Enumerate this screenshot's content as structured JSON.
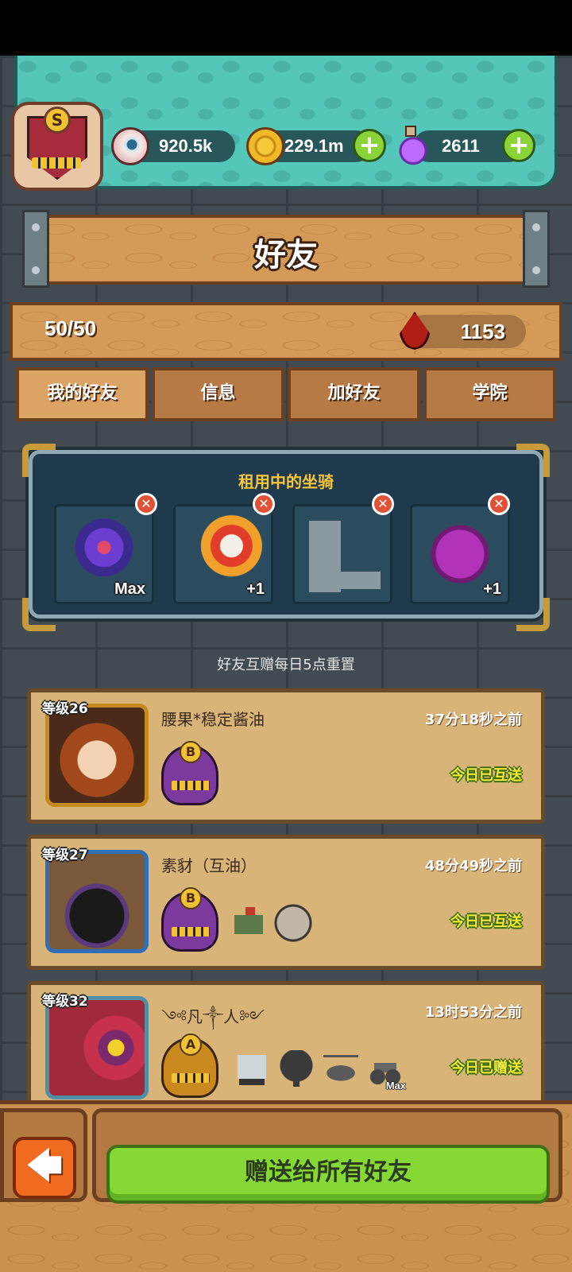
{
  "resources": {
    "eyes": "920.5k",
    "coins": "229.1m",
    "potions": "2611",
    "rank_letter": "S"
  },
  "header": {
    "title": "好友"
  },
  "friends_count": "50/50",
  "blood": "1153",
  "tabs": [
    {
      "label": "我的好友",
      "active": true
    },
    {
      "label": "信息",
      "active": false
    },
    {
      "label": "加好友",
      "active": false
    },
    {
      "label": "学院",
      "active": false
    }
  ],
  "rented_mounts": {
    "title": "租用中的坐骑",
    "slots": [
      {
        "icon": "rose-mount-icon",
        "badge": "Max"
      },
      {
        "icon": "lion-dance-mount-icon",
        "badge": "+1"
      },
      {
        "icon": "machine-mount-icon",
        "badge": ""
      },
      {
        "icon": "purple-monster-mount-icon",
        "badge": "+1"
      }
    ]
  },
  "reset_note": "好友互赠每日5点重置",
  "friends": [
    {
      "level": "等级26",
      "name": "腰果*稳定酱油",
      "time": "37分18秒之前",
      "status": "今日已互送",
      "grade": "B",
      "avatar": "girl-avatar-icon",
      "mounts": []
    },
    {
      "level": "等级27",
      "name": "素豺（互油）",
      "time": "48分49秒之前",
      "status": "今日已互送",
      "grade": "B",
      "avatar": "horned-monster-avatar-icon",
      "mounts": [
        {
          "icon": "cart-mount-icon",
          "badge": ""
        },
        {
          "icon": "moon-mount-icon",
          "badge": ""
        }
      ]
    },
    {
      "level": "等级32",
      "name": "༺凡༒人༻",
      "time": "13时53分之前",
      "status": "今日已赠送",
      "grade": "A",
      "avatar": "worm-avatar-icon",
      "mounts": [
        {
          "icon": "robot-mount-icon",
          "badge": ""
        },
        {
          "icon": "tree-mount-icon",
          "badge": ""
        },
        {
          "icon": "helicopter-mount-icon",
          "badge": ""
        },
        {
          "icon": "bike-mount-icon",
          "badge": "Max"
        }
      ]
    }
  ],
  "bottom": {
    "back_label": "🡄",
    "gift_all_label": "赠送给所有好友"
  },
  "colors": {
    "accent_green": "#86d934",
    "status_yellow": "#f7ea3a",
    "wood": "#d49a58",
    "teal": "#54c6ba"
  }
}
